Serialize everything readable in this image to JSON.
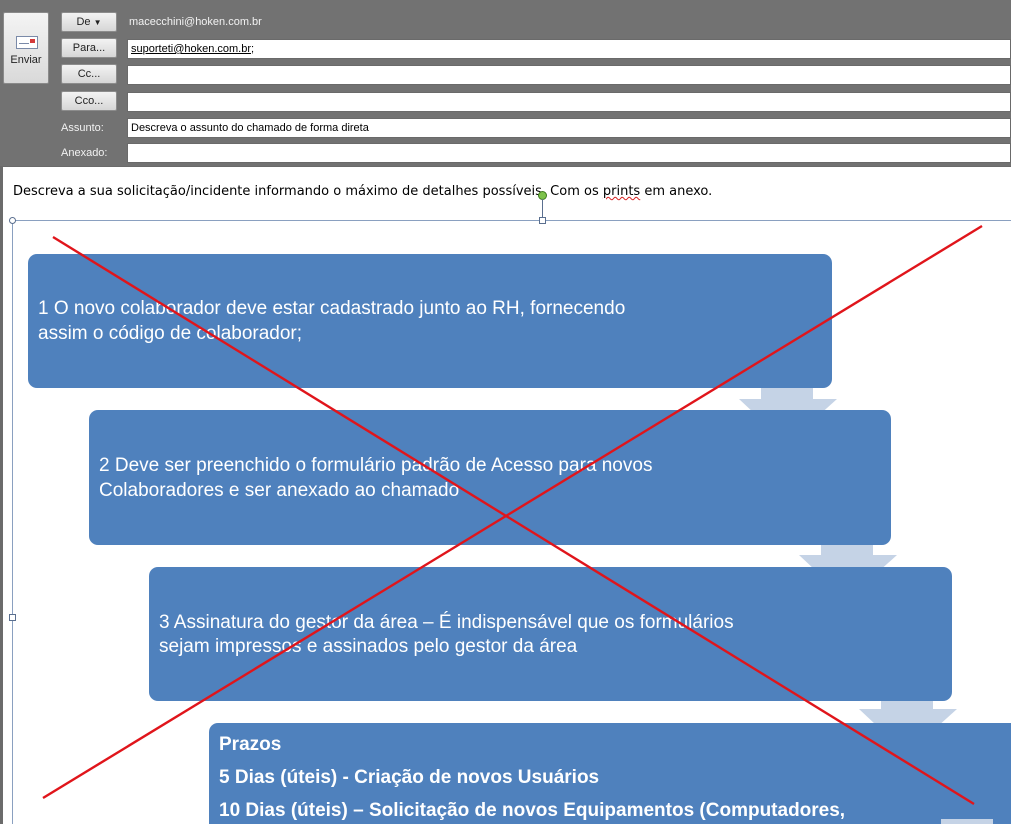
{
  "header": {
    "send_label": "Enviar",
    "from_button": "De",
    "from_value": "macecchini@hoken.com.br",
    "to_button": "Para...",
    "to_value": "suporteti@hoken.com.br",
    "to_separator": ";",
    "cc_button": "Cc...",
    "cc_value": "",
    "bcc_button": "Cco...",
    "bcc_value": "",
    "subject_label": "Assunto:",
    "subject_value": "Descreva o assunto do chamado de forma direta",
    "attachment_label": "Anexado:",
    "attachment_value": ""
  },
  "body": {
    "text_part1": "Descreva a sua solicitação/incidente informando o máximo de detalhes possíveis.",
    "text_part2": " Com os ",
    "text_part3": "prints",
    "text_part4": " em anexo.",
    "steps": [
      {
        "line1": "1  O novo colaborador deve estar cadastrado junto ao RH, fornecendo",
        "line2": "assim o código de colaborador;"
      },
      {
        "line1": "2  Deve ser preenchido o formulário padrão de Acesso para novos",
        "line2": "Colaboradores e ser anexado ao chamado"
      },
      {
        "line1": "3  Assinatura do gestor da área – É indispensável que os formulários",
        "line2": "sejam impressos e assinados pelo gestor da área"
      }
    ],
    "prazos": {
      "title": "Prazos",
      "line1": "5 Dias (úteis) -  Criação de novos Usuários",
      "line2": "10 Dias (úteis) – Solicitação de novos Equipamentos (Computadores,"
    }
  },
  "colors": {
    "box": "#4f81bd",
    "arrow": "#c5d3e6",
    "cross": "#e0151b"
  },
  "icons": [
    "envelope-icon",
    "dropdown-arrow-icon"
  ]
}
